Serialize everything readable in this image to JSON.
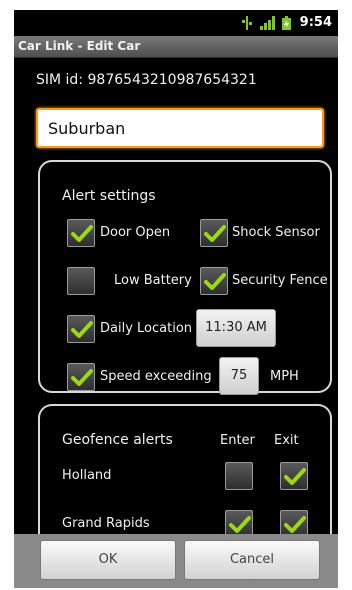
{
  "status_bar": {
    "time": "9:54"
  },
  "title_bar": {
    "title": "Car Link - Edit Car"
  },
  "sim": {
    "label": "SIM id:",
    "value": "9876543210987654321"
  },
  "car_name": {
    "value": "Suburban"
  },
  "alert_settings": {
    "heading": "Alert settings",
    "door_open": {
      "label": "Door Open",
      "checked": true
    },
    "shock_sensor": {
      "label": "Shock Sensor",
      "checked": true
    },
    "low_battery": {
      "label": "Low Battery",
      "checked": false
    },
    "security_fence": {
      "label": "Security Fence",
      "checked": true
    },
    "daily_location": {
      "label": "Daily Location",
      "checked": true,
      "time": "11:30 AM"
    },
    "speed_exceeding": {
      "label": "Speed exceeding",
      "checked": true,
      "value": "75",
      "unit": "MPH"
    }
  },
  "geofence": {
    "heading": "Geofence alerts",
    "col_enter": "Enter",
    "col_exit": "Exit",
    "rows": [
      {
        "name": "Holland",
        "enter": false,
        "exit": true
      },
      {
        "name": "Grand Rapids",
        "enter": true,
        "exit": true
      }
    ]
  },
  "buttons": {
    "ok": "OK",
    "cancel": "Cancel"
  },
  "colors": {
    "accent": "#ff9a18",
    "check": "#9ad81a"
  }
}
